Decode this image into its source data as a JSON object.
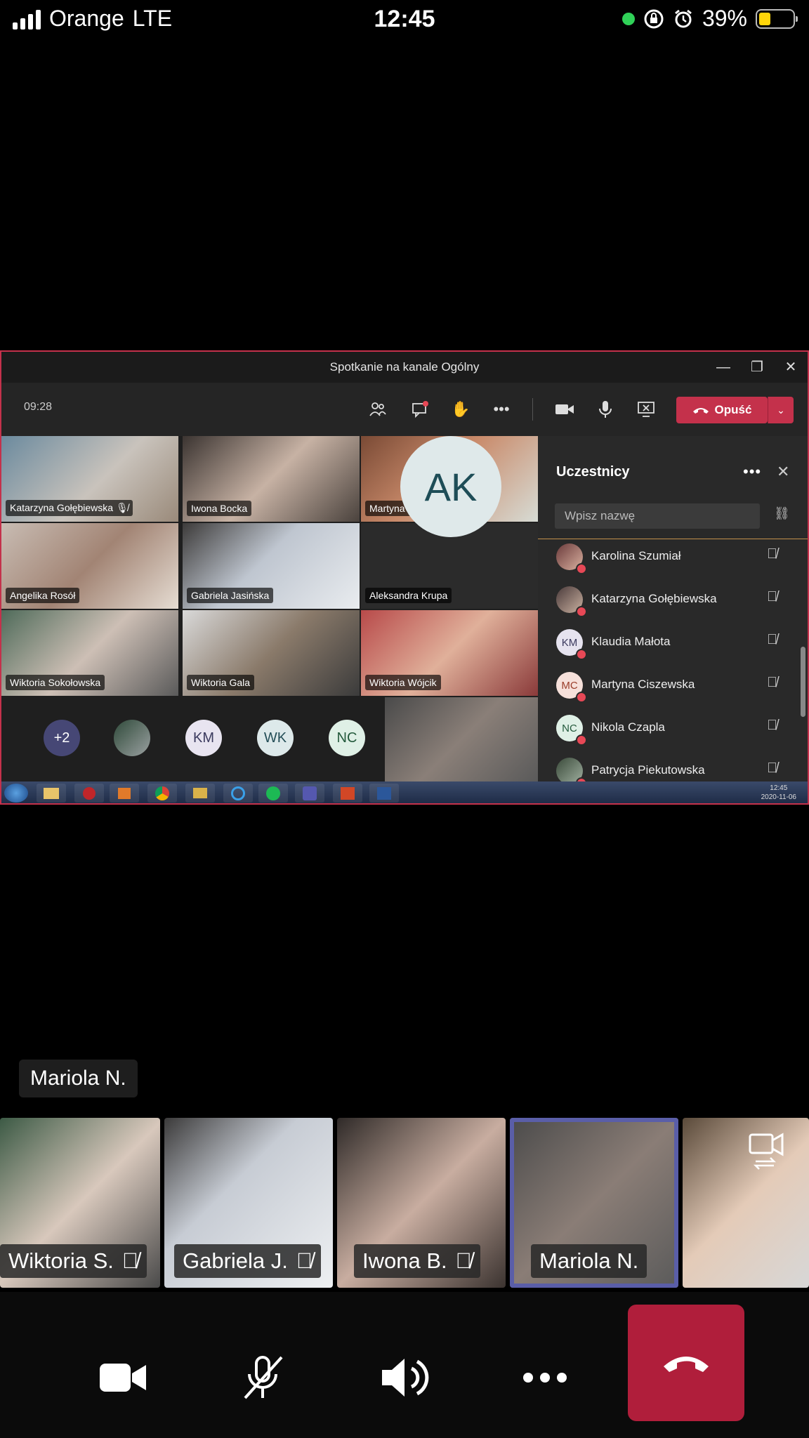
{
  "status_bar": {
    "carrier": "Orange",
    "network": "LTE",
    "time": "12:45",
    "battery": "39%"
  },
  "teams_window": {
    "title": "Spotkanie na kanale Ogólny",
    "timer": "09:28",
    "leave_label": "Opuść",
    "video_tiles": [
      {
        "name": "Katarzyna Gołębiewska"
      },
      {
        "name": "Iwona Bocka"
      },
      {
        "name": "Martyna Ciszewska"
      },
      {
        "name": "Angelika Rosół"
      },
      {
        "name": "Gabriela Jasińska"
      },
      {
        "name": "Aleksandra Krupa",
        "initials": "AK"
      },
      {
        "name": "Wiktoria Sokołowska"
      },
      {
        "name": "Wiktoria Gala"
      },
      {
        "name": "Wiktoria Wójcik"
      }
    ],
    "overflow": {
      "more_count": "+2",
      "initials": [
        "KM",
        "WK",
        "NC"
      ]
    },
    "participants_panel": {
      "title": "Uczestnicy",
      "search_placeholder": "Wpisz nazwę",
      "participants": [
        {
          "name": "Karolina Szumiał",
          "initials": ""
        },
        {
          "name": "Katarzyna Gołębiewska",
          "initials": ""
        },
        {
          "name": "Klaudia Małota",
          "initials": "KM"
        },
        {
          "name": "Martyna Ciszewska",
          "initials": "MC"
        },
        {
          "name": "Nikola Czapla",
          "initials": "NC"
        },
        {
          "name": "Patrycja Piekutowska",
          "initials": ""
        }
      ]
    },
    "taskbar": {
      "clock_time": "12:45",
      "clock_date": "2020-11-06"
    }
  },
  "mobile_call": {
    "active_speaker": "Mariola N.",
    "strip": [
      {
        "name": "Wiktoria S."
      },
      {
        "name": "Gabriela J."
      },
      {
        "name": "Iwona B."
      },
      {
        "name": "Mariola N."
      },
      {
        "name": ""
      }
    ]
  },
  "colors": {
    "accent_red": "#c4314b",
    "hangup_red": "#b01e3b",
    "active_border": "#5a5ea8"
  }
}
